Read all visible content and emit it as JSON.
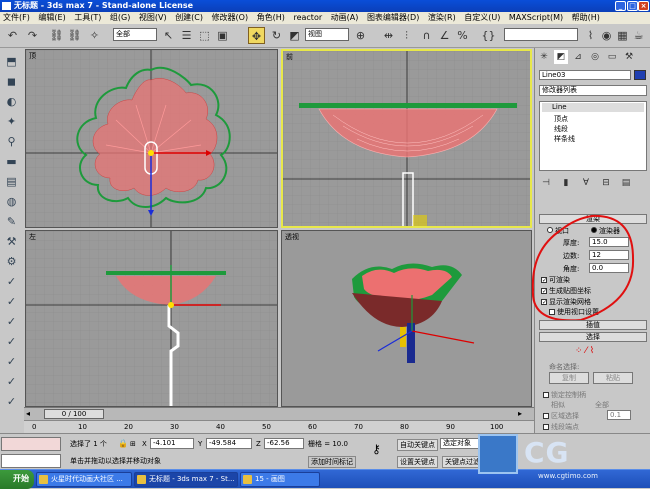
{
  "window": {
    "title": "无标题 - 3ds max 7 - Stand-alone License"
  },
  "menu": [
    "文件(F)",
    "编辑(E)",
    "工具(T)",
    "组(G)",
    "视图(V)",
    "创建(C)",
    "修改器(O)",
    "角色(H)",
    "reactor",
    "动画(A)",
    "图表编辑器(D)",
    "渲染(R)",
    "自定义(U)",
    "MAXScript(M)",
    "帮助(H)"
  ],
  "toolbar": {
    "selection_filter": "全部",
    "coord_system": "视图"
  },
  "viewports": {
    "top": "顶",
    "front": "前",
    "left": "左",
    "perspective": "透视"
  },
  "command_panel": {
    "object_name": "Line03",
    "object_color": "#1f3fb0",
    "modifier_list": "修改器列表",
    "stack": {
      "root": "Line",
      "items": [
        "顶点",
        "线段",
        "样条线"
      ]
    },
    "render_rollout": {
      "title": "渲染",
      "radio_viewport": "视口",
      "radio_renderer": "渲染器",
      "thickness_label": "厚度:",
      "thickness_value": "15.0",
      "sides_label": "边数:",
      "sides_value": "12",
      "angle_label": "角度:",
      "angle_value": "0.0",
      "renderable": "可渲染",
      "gen_mapping": "生成贴图坐标",
      "show_mesh": "显示渲染网格",
      "use_viewport": "使用视口设置"
    },
    "interp_rollout": "插值",
    "select_rollout": "选择",
    "named_sel_title": "命名选择:",
    "copy_btn": "复制",
    "paste_btn": "粘贴",
    "lock_handles": "锁定控制柄",
    "similar": "相似",
    "all": "全部",
    "area_select": "区域选择",
    "area_value": "0.1",
    "segment_end": "线段端点"
  },
  "timeline": {
    "frame": "0 / 100"
  },
  "ruler": [
    "0",
    "10",
    "20",
    "30",
    "40",
    "50",
    "60",
    "70",
    "80",
    "90",
    "100"
  ],
  "status": {
    "selected": "选择了 1 个",
    "prompt": "单击并拖动以选择并移动对象",
    "x_label": "X",
    "x_value": "-4.101",
    "y_label": "Y",
    "y_value": "-49.584",
    "z_label": "Z",
    "z_value": "-62.56",
    "grid": "栅格 = 10.0",
    "add_tag": "添加时间标记",
    "auto_key": "自动关键点",
    "selected_obj": "选定对象",
    "set_key": "设置关键点",
    "key_filters": "关键点过滤器..."
  },
  "taskbar": {
    "start": "开始",
    "tasks": [
      "火星时代动画大社区 ...",
      "无标题 - 3ds max 7 - St...",
      "15 - 画图"
    ]
  },
  "watermark": {
    "brand": "CG",
    "site": "www.cgtimo.com"
  }
}
